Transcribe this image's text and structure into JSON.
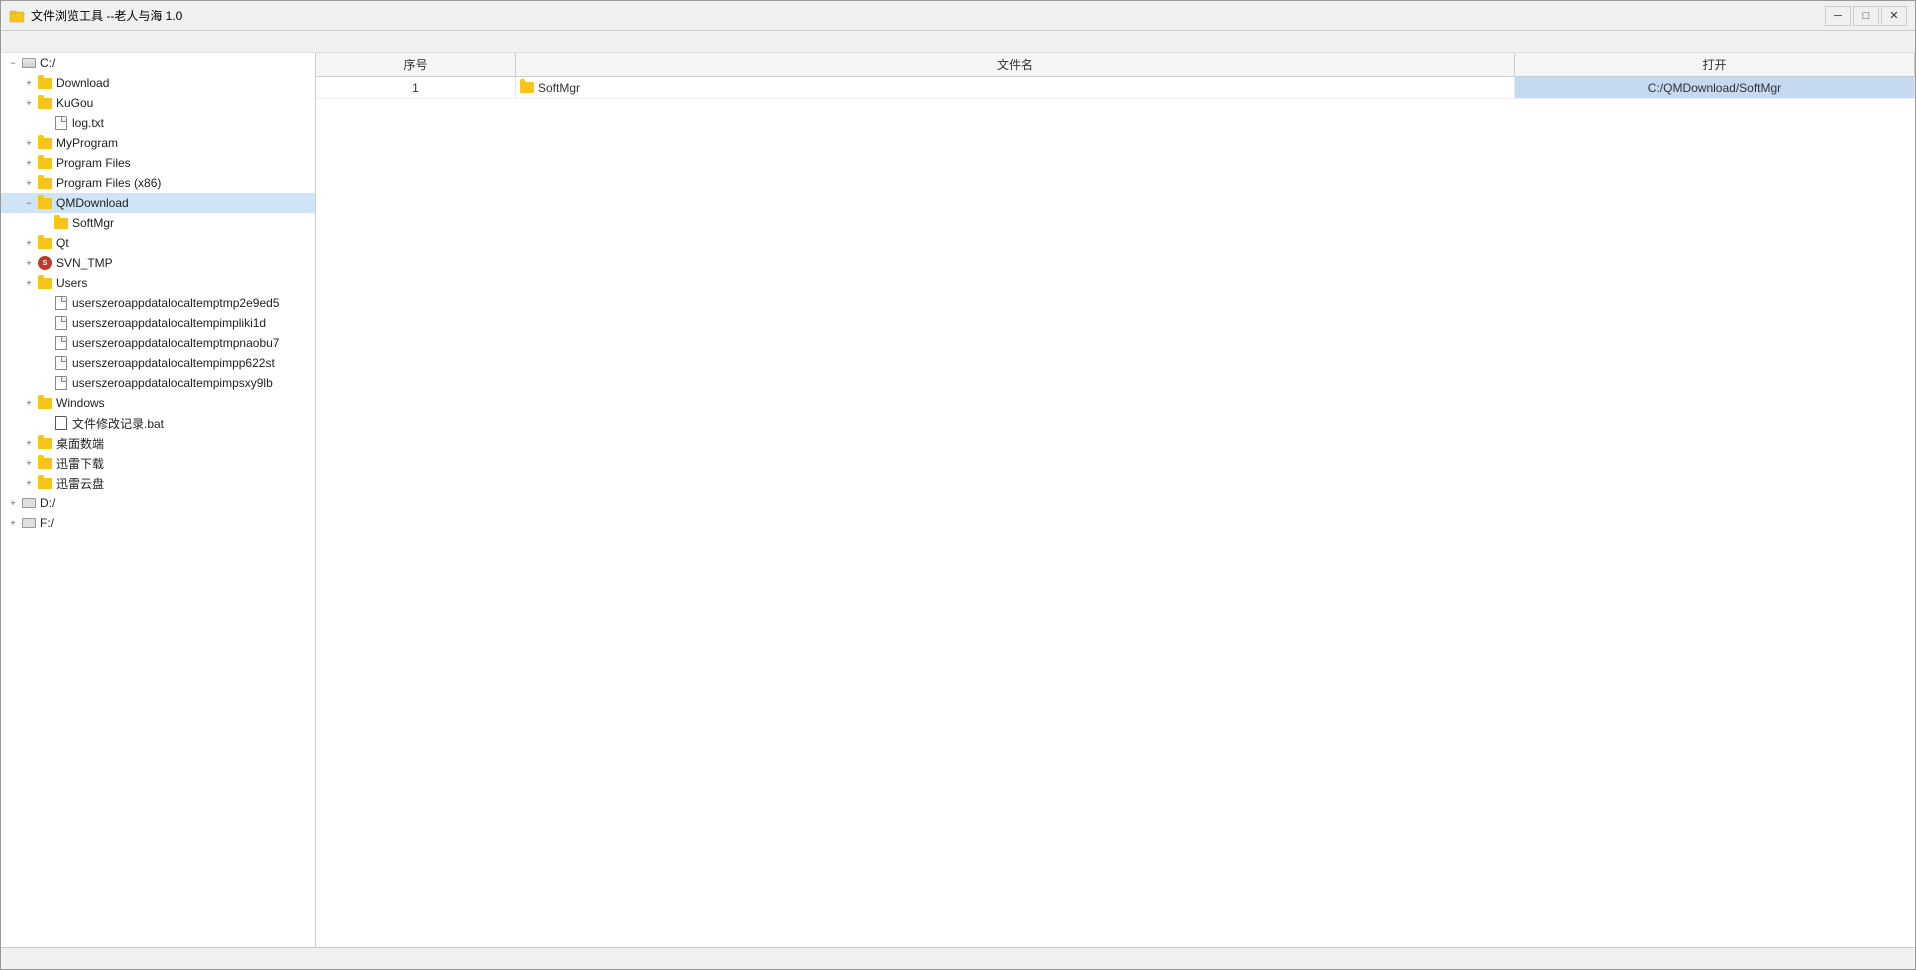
{
  "window": {
    "title": "文件浏览工具 --老人与海 1.0",
    "icon": "📁"
  },
  "titlebar": {
    "minimize_label": "─",
    "maximize_label": "□",
    "close_label": "✕"
  },
  "menubar": {
    "items": []
  },
  "tree": {
    "items": [
      {
        "id": "c-drive",
        "label": "C:/",
        "type": "drive",
        "indent": 0,
        "expanded": true,
        "toggle": "−"
      },
      {
        "id": "download",
        "label": "Download",
        "type": "folder",
        "indent": 1,
        "expanded": false,
        "toggle": "+"
      },
      {
        "id": "kugou",
        "label": "KuGou",
        "type": "folder",
        "indent": 1,
        "expanded": false,
        "toggle": "+"
      },
      {
        "id": "log-txt",
        "label": "log.txt",
        "type": "file",
        "indent": 2,
        "expanded": false,
        "toggle": ""
      },
      {
        "id": "myprogram",
        "label": "MyProgram",
        "type": "folder",
        "indent": 1,
        "expanded": false,
        "toggle": "+"
      },
      {
        "id": "program-files",
        "label": "Program Files",
        "type": "folder",
        "indent": 1,
        "expanded": false,
        "toggle": "+"
      },
      {
        "id": "program-files-x86",
        "label": "Program Files (x86)",
        "type": "folder",
        "indent": 1,
        "expanded": false,
        "toggle": "+"
      },
      {
        "id": "qmdownload",
        "label": "QMDownload",
        "type": "folder",
        "indent": 1,
        "expanded": true,
        "toggle": "−",
        "selected": true
      },
      {
        "id": "softmgr",
        "label": "SoftMgr",
        "type": "folder",
        "indent": 2,
        "expanded": false,
        "toggle": ""
      },
      {
        "id": "qt",
        "label": "Qt",
        "type": "folder",
        "indent": 1,
        "expanded": false,
        "toggle": "+"
      },
      {
        "id": "svn-tmp",
        "label": "SVN_TMP",
        "type": "svn-folder",
        "indent": 1,
        "expanded": false,
        "toggle": "+"
      },
      {
        "id": "users",
        "label": "Users",
        "type": "folder",
        "indent": 1,
        "expanded": false,
        "toggle": "+"
      },
      {
        "id": "user-file1",
        "label": "userszeroappdatalocaltemptmp2e9ed5",
        "type": "file",
        "indent": 2,
        "expanded": false,
        "toggle": ""
      },
      {
        "id": "user-file2",
        "label": "userszeroappdatalocaltempimpliki1d",
        "type": "file",
        "indent": 2,
        "expanded": false,
        "toggle": ""
      },
      {
        "id": "user-file3",
        "label": "userszeroappdatalocaltemptmpnaobu7",
        "type": "file",
        "indent": 2,
        "expanded": false,
        "toggle": ""
      },
      {
        "id": "user-file4",
        "label": "userszeroappdatalocaltempimpp622st",
        "type": "file",
        "indent": 2,
        "expanded": false,
        "toggle": ""
      },
      {
        "id": "user-file5",
        "label": "userszeroappdatalocaltempimpsxy9lb",
        "type": "file",
        "indent": 2,
        "expanded": false,
        "toggle": ""
      },
      {
        "id": "windows",
        "label": "Windows",
        "type": "folder",
        "indent": 1,
        "expanded": false,
        "toggle": "+"
      },
      {
        "id": "bat-file",
        "label": "文件修改记录.bat",
        "type": "bat",
        "indent": 2,
        "expanded": false,
        "toggle": ""
      },
      {
        "id": "desktop",
        "label": "桌面数端",
        "type": "folder",
        "indent": 1,
        "expanded": false,
        "toggle": "+"
      },
      {
        "id": "xunlei-down",
        "label": "迅雷下载",
        "type": "folder",
        "indent": 1,
        "expanded": false,
        "toggle": "+"
      },
      {
        "id": "xunlei-cloud",
        "label": "迅雷云盘",
        "type": "folder",
        "indent": 1,
        "expanded": false,
        "toggle": "+"
      },
      {
        "id": "d-drive",
        "label": "D:/",
        "type": "drive",
        "indent": 0,
        "expanded": false,
        "toggle": "+"
      },
      {
        "id": "f-drive",
        "label": "F:/",
        "type": "drive",
        "indent": 0,
        "expanded": false,
        "toggle": "+"
      }
    ]
  },
  "table": {
    "headers": {
      "seq": "序号",
      "name": "文件名",
      "open": "打开"
    },
    "rows": [
      {
        "seq": "1",
        "name": "SoftMgr",
        "type": "folder",
        "path": "C:/QMDownload/SoftMgr",
        "selected": true
      }
    ]
  }
}
